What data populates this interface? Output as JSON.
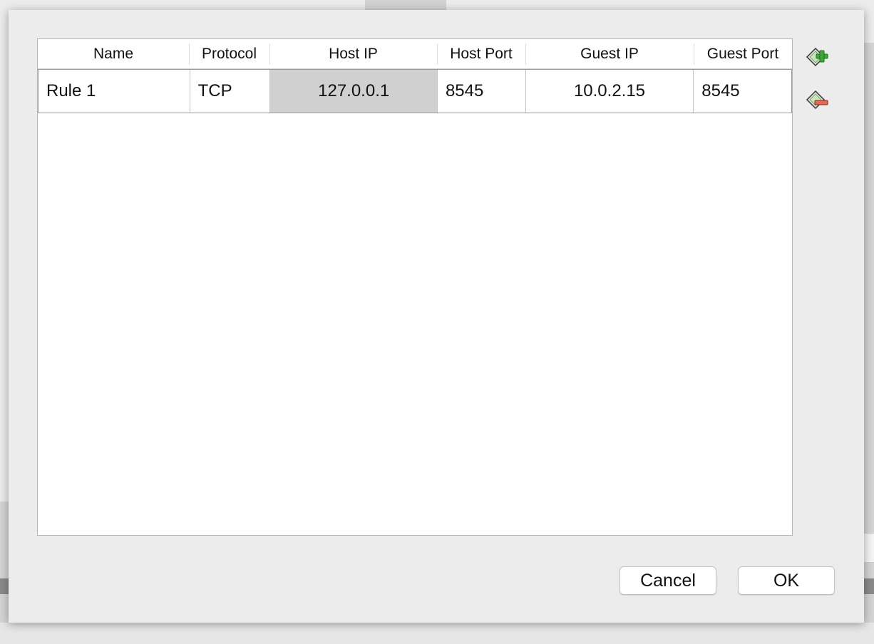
{
  "table": {
    "columns": [
      "Name",
      "Protocol",
      "Host IP",
      "Host Port",
      "Guest IP",
      "Guest Port"
    ],
    "rows": [
      {
        "name": "Rule 1",
        "protocol": "TCP",
        "host_ip": "127.0.0.1",
        "host_port": "8545",
        "guest_ip": "10.0.2.15",
        "guest_port": "8545"
      }
    ]
  },
  "side_buttons": {
    "add_icon": "add-rule-icon",
    "remove_icon": "remove-rule-icon"
  },
  "buttons": {
    "cancel_label": "Cancel",
    "ok_label": "OK"
  },
  "colors": {
    "selected_cell": "#d0d0d0",
    "add_accent": "#3fa83a",
    "remove_accent": "#d9534f"
  }
}
